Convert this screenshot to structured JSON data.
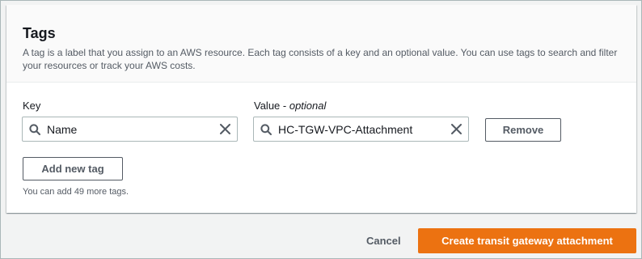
{
  "tags_panel": {
    "title": "Tags",
    "description": "A tag is a label that you assign to an AWS resource. Each tag consists of a key and an optional value. You can use tags to search and filter your resources or track your AWS costs."
  },
  "tag_row": {
    "key_label": "Key",
    "value_label_main": "Value - ",
    "value_label_optional": "optional",
    "key_value": "Name",
    "value_value": "HC-TGW-VPC-Attachment",
    "remove_label": "Remove"
  },
  "add_tag": {
    "button_label": "Add new tag",
    "hint": "You can add 49 more tags."
  },
  "footer": {
    "cancel_label": "Cancel",
    "submit_label": "Create transit gateway attachment"
  },
  "colors": {
    "primary": "#ec7211",
    "text": "#16191f",
    "secondary_text": "#545b64"
  },
  "icons": {
    "search": "search-icon",
    "clear": "close-icon"
  }
}
